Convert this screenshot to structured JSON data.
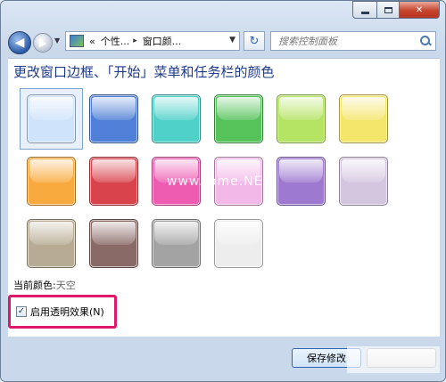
{
  "window": {
    "caption": {
      "minimize": "",
      "maximize": "",
      "close": "✕"
    }
  },
  "nav": {
    "back_glyph": "◀",
    "forward_glyph": "▶",
    "breadcrumb": [
      "«",
      "个性...",
      "▸",
      "窗口颜..."
    ],
    "search_placeholder": "搜索控制面板",
    "refresh_glyph": "↻"
  },
  "content": {
    "heading": "更改窗口边框、「开始」菜单和任务栏的颜色",
    "current_color_label": "当前颜色:",
    "current_color_value": "天空",
    "transparency_label": "启用透明效果(N)",
    "transparency_checked": true,
    "check_glyph": "✓",
    "watermark": "www.   ome.NE"
  },
  "swatches": [
    {
      "name": "sky",
      "color": "#cfe3fb",
      "row": 0,
      "col": 0
    },
    {
      "name": "twilight",
      "color": "#4f7fd6",
      "row": 0,
      "col": 1
    },
    {
      "name": "sea",
      "color": "#4fd0c9",
      "row": 0,
      "col": 2
    },
    {
      "name": "leaf",
      "color": "#55c25a",
      "row": 0,
      "col": 3
    },
    {
      "name": "lime",
      "color": "#b5e363",
      "row": 0,
      "col": 4
    },
    {
      "name": "sun",
      "color": "#f4e56b",
      "row": 0,
      "col": 5
    },
    {
      "name": "pumpkin",
      "color": "#f8aa3e",
      "row": 1,
      "col": 0
    },
    {
      "name": "ruby",
      "color": "#d9434c",
      "row": 1,
      "col": 1
    },
    {
      "name": "fuchsia",
      "color": "#ee5cb2",
      "row": 1,
      "col": 2
    },
    {
      "name": "blush",
      "color": "#f2b8e8",
      "row": 1,
      "col": 3
    },
    {
      "name": "violet",
      "color": "#9d79cf",
      "row": 1,
      "col": 4
    },
    {
      "name": "lavender",
      "color": "#d5c6e0",
      "row": 1,
      "col": 5
    },
    {
      "name": "taupe",
      "color": "#b7ab93",
      "row": 2,
      "col": 0
    },
    {
      "name": "chocolate",
      "color": "#8a6a66",
      "row": 2,
      "col": 1
    },
    {
      "name": "slate",
      "color": "#a3a3a3",
      "row": 2,
      "col": 2
    },
    {
      "name": "frost",
      "color": "#ededed",
      "row": 2,
      "col": 3
    }
  ],
  "footer": {
    "save_label": "保存修改",
    "cancel_label": ""
  }
}
